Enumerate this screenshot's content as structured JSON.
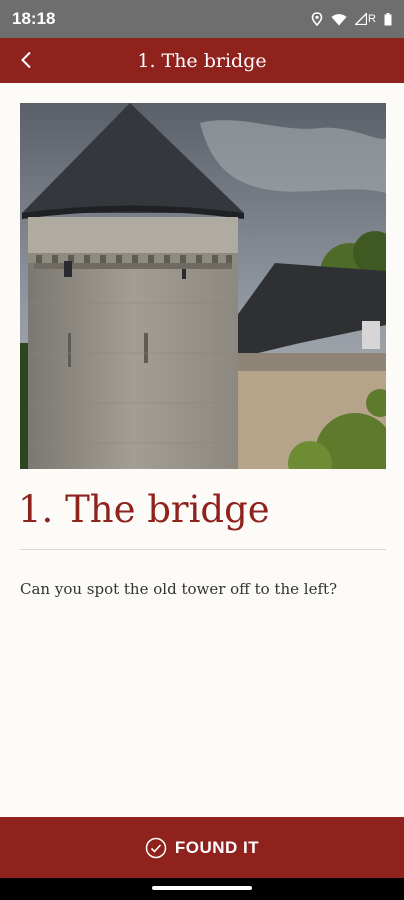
{
  "status": {
    "time": "18:18",
    "carrier_letter": "R"
  },
  "header": {
    "title": "1. The bridge"
  },
  "main": {
    "title": "1. The bridge",
    "description": "Can you spot the old tower off to the left?"
  },
  "footer": {
    "button_label": "FOUND IT"
  },
  "colors": {
    "brand": "#8f221d",
    "background": "#fdfbf8",
    "status_bar": "#6e6e6e"
  },
  "icons": {
    "back": "chevron-left-icon",
    "found": "check-circle-icon"
  }
}
